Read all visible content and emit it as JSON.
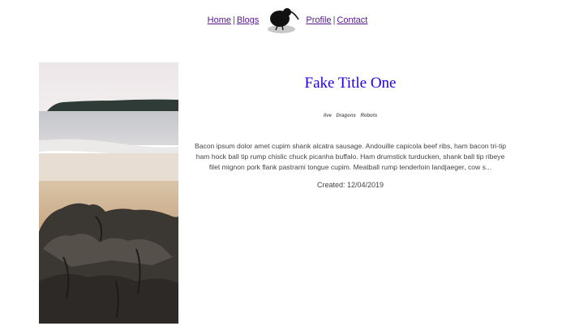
{
  "nav": {
    "home": "Home",
    "blogs": "Blogs",
    "profile": "Profile",
    "contact": "Contact",
    "separator": "|",
    "logo_icon": "kiwi-bird-icon"
  },
  "post": {
    "title": "Fake Title One",
    "tags": [
      "live",
      "Dragons",
      "Robots"
    ],
    "body": "Bacon ipsum dolor amet cupim shank alcatra sausage. Andouille capicola beef ribs, ham bacon tri-tip ham hock ball tip rump chislic chuck picanha buffalo. Ham drumstick turducken, shank ball tip ribeye filet mignon pork flank pastrami tongue cupim. Meatball rump tenderloin landjaeger, cow s...",
    "created": "Created: 12/04/2019",
    "image": "beach-rocks-photo"
  },
  "colors": {
    "title": "#2200e6",
    "link": "#551a8b"
  }
}
